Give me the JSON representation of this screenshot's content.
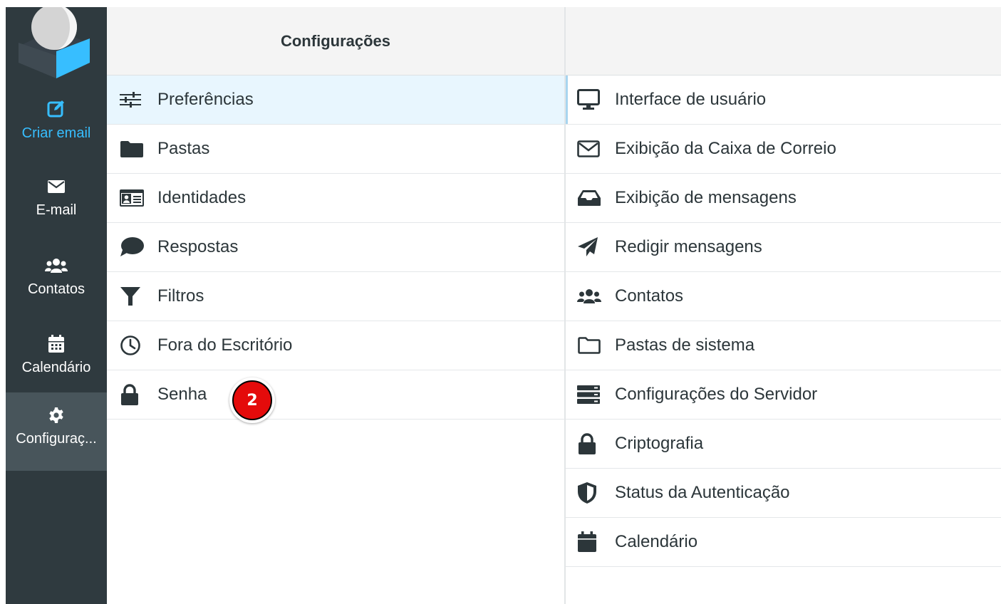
{
  "nav": {
    "compose_label": "Criar email",
    "mail_label": "E-mail",
    "contacts_label": "Contatos",
    "calendar_label": "Calendário",
    "settings_label": "Configuraç..."
  },
  "settings_panel": {
    "title": "Configurações",
    "sections": [
      {
        "label": "Preferências",
        "icon": "sliders-icon"
      },
      {
        "label": "Pastas",
        "icon": "folder-icon"
      },
      {
        "label": "Identidades",
        "icon": "id-card-icon"
      },
      {
        "label": "Respostas",
        "icon": "speech-bubble-icon"
      },
      {
        "label": "Filtros",
        "icon": "filter-icon"
      },
      {
        "label": "Fora do Escritório",
        "icon": "clock-icon"
      },
      {
        "label": "Senha",
        "icon": "lock-icon"
      }
    ],
    "badge_number": "2"
  },
  "preferences_panel": {
    "items": [
      {
        "label": "Interface de usuário",
        "icon": "monitor-icon"
      },
      {
        "label": "Exibição da Caixa de Correio",
        "icon": "envelope-outline-icon"
      },
      {
        "label": "Exibição de mensagens",
        "icon": "inbox-icon"
      },
      {
        "label": "Redigir mensagens",
        "icon": "paper-plane-icon"
      },
      {
        "label": "Contatos",
        "icon": "users-icon"
      },
      {
        "label": "Pastas de sistema",
        "icon": "folder-outline-icon"
      },
      {
        "label": "Configurações do Servidor",
        "icon": "server-icon"
      },
      {
        "label": "Criptografia",
        "icon": "lock-icon"
      },
      {
        "label": "Status da Autenticação",
        "icon": "shield-icon"
      },
      {
        "label": "Calendário",
        "icon": "calendar-icon"
      }
    ]
  },
  "colors": {
    "nav_bg": "#2f3a3f",
    "nav_active_bg": "#48555b",
    "accent": "#37beff",
    "selected_bg": "#e8f6fe",
    "badge_red": "#e40b0b"
  }
}
